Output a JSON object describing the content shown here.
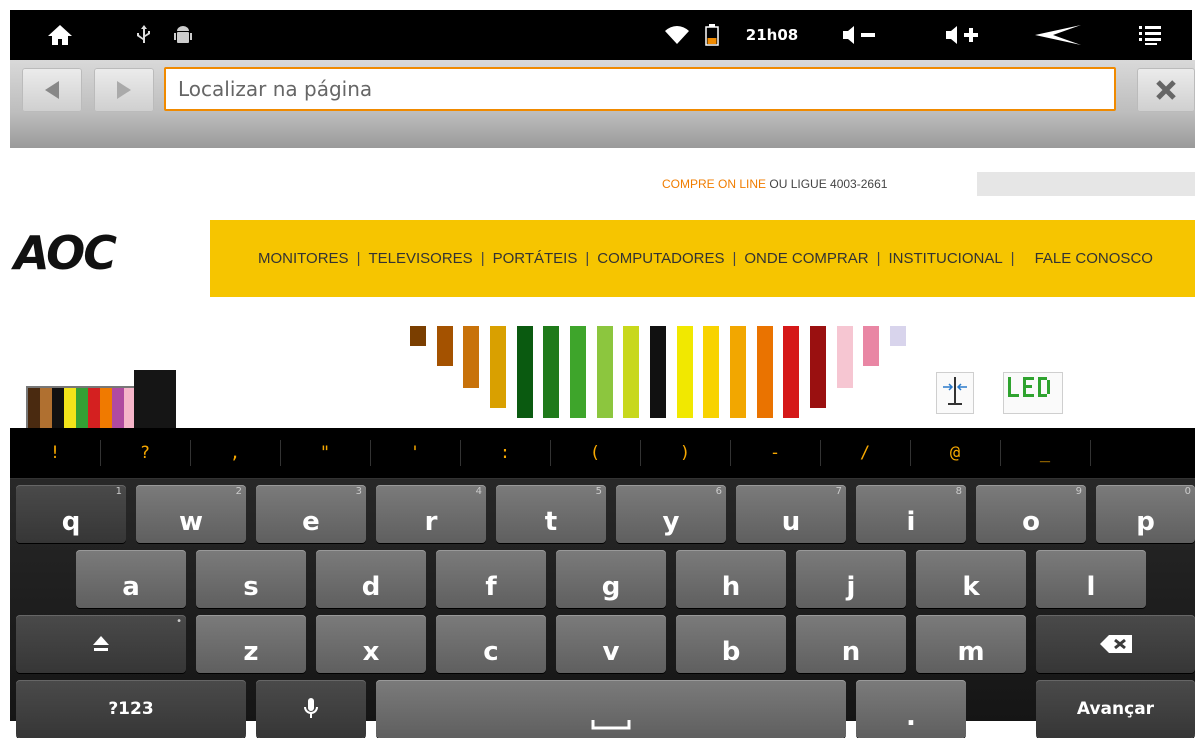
{
  "status_bar": {
    "time": "21h08",
    "icons": [
      "home-icon",
      "usb-icon",
      "android-debug-icon",
      "wifi-icon",
      "battery-icon",
      "volume-down-icon",
      "volume-up-icon",
      "back-icon",
      "menu-icon"
    ],
    "battery_color": "#f08a00"
  },
  "find_bar": {
    "placeholder": "Localizar na página",
    "accent": "#f08a00"
  },
  "web": {
    "top_link": "COMPRE ON LINE",
    "top_text": "OU LIGUE 4003-2661",
    "logo": "AOC",
    "menu": [
      "MONITORES",
      "TELEVISORES",
      "PORTÁTEIS",
      "COMPUTADORES",
      "ONDE COMPRAR",
      "INSTITUCIONAL",
      "FALE CONOSCO"
    ],
    "menu_bar_color": "#f6c500"
  },
  "keyboard": {
    "symbols": [
      "!",
      "?",
      ",",
      "\"",
      "'",
      ":",
      "(",
      ")",
      "-",
      "/",
      "@",
      "_"
    ],
    "row1": [
      {
        "k": "q",
        "h": "1"
      },
      {
        "k": "w",
        "h": "2"
      },
      {
        "k": "e",
        "h": "3"
      },
      {
        "k": "r",
        "h": "4"
      },
      {
        "k": "t",
        "h": "5"
      },
      {
        "k": "y",
        "h": "6"
      },
      {
        "k": "u",
        "h": "7"
      },
      {
        "k": "i",
        "h": "8"
      },
      {
        "k": "o",
        "h": "9"
      },
      {
        "k": "p",
        "h": "0"
      }
    ],
    "row2": [
      "a",
      "s",
      "d",
      "f",
      "g",
      "h",
      "j",
      "k",
      "l"
    ],
    "row3": [
      "z",
      "x",
      "c",
      "v",
      "b",
      "n",
      "m"
    ],
    "symbols_key": "?123",
    "action_key": "Avançar",
    "period_key": "."
  }
}
